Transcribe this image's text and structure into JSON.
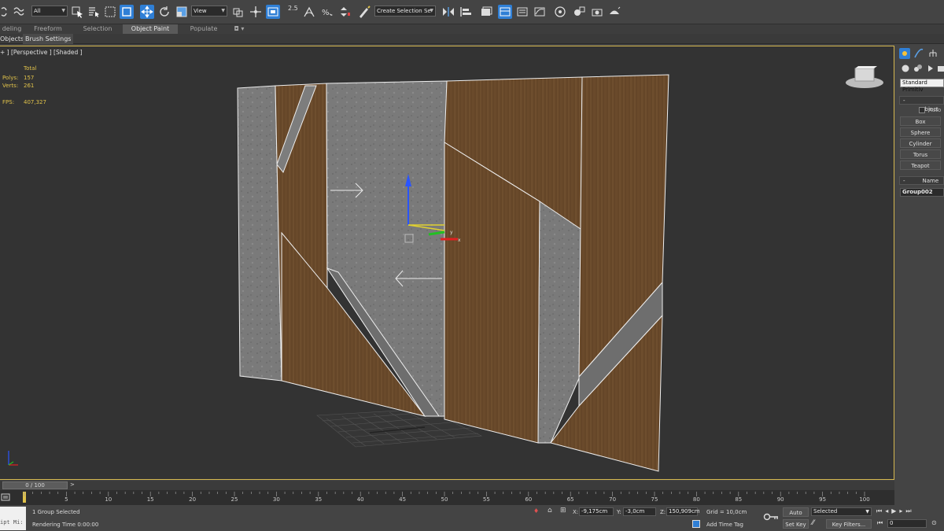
{
  "toolbar": {
    "filter_value": "All",
    "ref_coord_value": "View",
    "snap_label": "2.5",
    "named_selection_value": "Create Selection Se"
  },
  "ribbon": {
    "tabs": [
      "deling",
      "Freeform",
      "Selection",
      "Object Paint",
      "Populate"
    ],
    "active": "Object Paint",
    "sub_tabs": [
      "Objects",
      "Brush Settings"
    ]
  },
  "viewport": {
    "label": "+ ] [Perspective ] [Shaded ]",
    "stats": {
      "total_label": "Total",
      "polys_label": "Polys:",
      "polys_value": "157",
      "verts_label": "Verts:",
      "verts_value": "261",
      "fps_label": "FPS:",
      "fps_value": "407,327"
    },
    "gizmo": {
      "x_label": "x",
      "y_label": "y"
    }
  },
  "command_panel": {
    "dropdown_value": "Standard Primitiv",
    "object_type_label": "Object",
    "autogrid_label": "Auto",
    "buttons": [
      "Box",
      "Sphere",
      "Cylinder",
      "Torus",
      "Teapot"
    ],
    "name_rollout_label": "Name ar",
    "object_name": "Group002"
  },
  "timeline": {
    "slider_label": "0 / 100",
    "next_label": ">",
    "ticks": [
      "5",
      "10",
      "15",
      "20",
      "25",
      "30",
      "35",
      "40",
      "45",
      "50",
      "55",
      "60",
      "65",
      "70",
      "75",
      "80",
      "85",
      "90",
      "95",
      "100"
    ]
  },
  "status": {
    "maxscript_label": "ipt Mi:",
    "selection_info": "1 Group Selected",
    "render_time": "Rendering Time  0:00:00",
    "x_label": "X:",
    "x_value": "-9,175cm",
    "y_label": "Y:",
    "y_value": "-3,0cm",
    "z_label": "Z:",
    "z_value": "150,909cm",
    "grid": "Grid = 10,0cm",
    "add_time_tag": "Add Time Tag",
    "auto_key": "Auto Key",
    "set_key": "Set Key",
    "selected_value": "Selected",
    "key_filters": "Key Filters...",
    "frame_value": "0"
  },
  "colors": {
    "accent": "#2f7fd6",
    "viewport_border": "#d5b850",
    "stats_text": "#e0c24a",
    "wood": "#6b4a2a",
    "concrete": "#7c7c7c"
  }
}
